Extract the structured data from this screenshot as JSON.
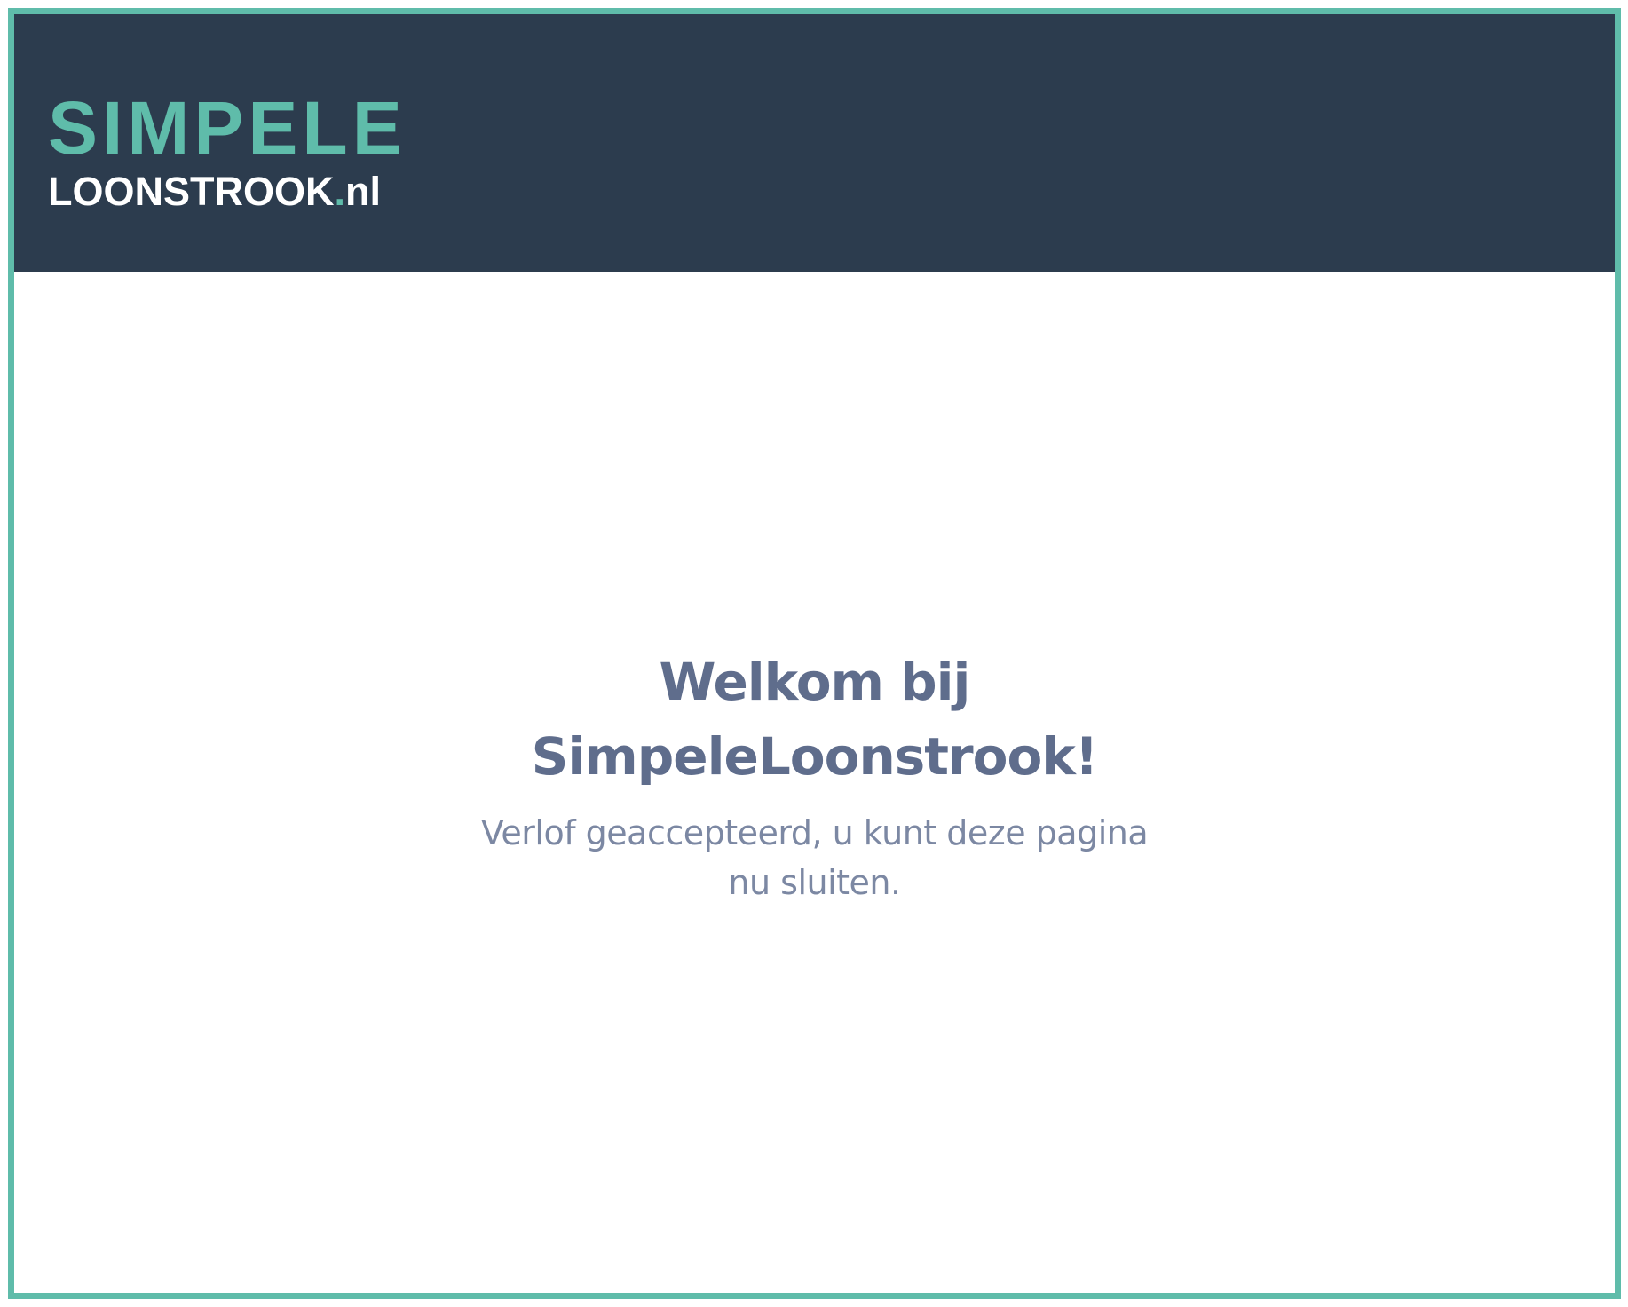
{
  "colors": {
    "frame_border": "#5fbcaa",
    "header_background": "#2c3c4e",
    "brand_accent": "#5fbcaa",
    "logo_light": "#ffffff",
    "heading_text": "#5f6d8c",
    "body_text": "#7c88a3"
  },
  "header": {
    "logo": {
      "line1": "SIMPELE",
      "line2_main": "LOONSTROOK",
      "line2_dot": ".",
      "line2_tld": "nl"
    }
  },
  "main": {
    "heading": "Welkom bij SimpeleLoonstrook!",
    "message": "Verlof geaccepteerd, u kunt deze pagina nu sluiten."
  }
}
